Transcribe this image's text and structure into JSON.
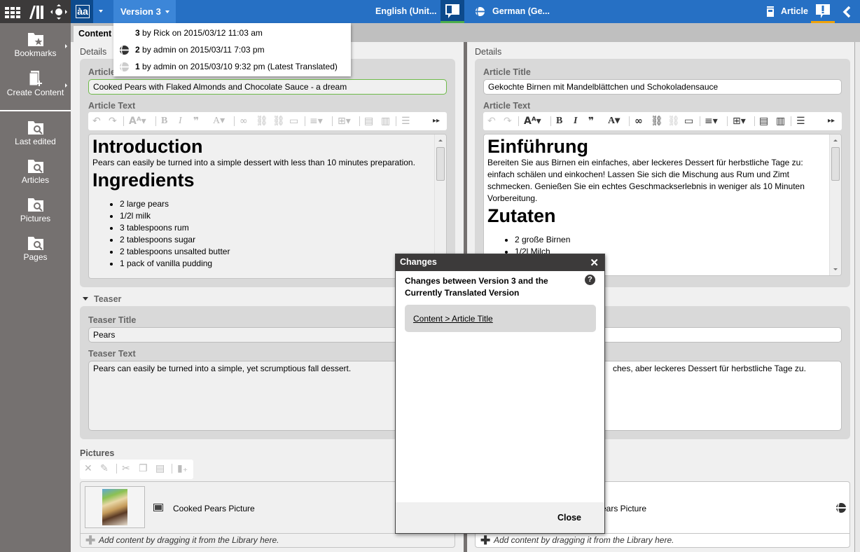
{
  "app_bar": {
    "icons": [
      "apps-grid-icon",
      "library-icon",
      "navigation-icon"
    ]
  },
  "sidebar": {
    "items": [
      {
        "label": "Bookmarks",
        "icon": "bookmark-folder-icon",
        "has_submenu": true
      },
      {
        "label": "Create Content",
        "icon": "create-content-icon",
        "has_submenu": true
      },
      {
        "label": "Last edited",
        "icon": "folder-search-icon"
      },
      {
        "label": "Articles",
        "icon": "folder-search-icon"
      },
      {
        "label": "Pictures",
        "icon": "folder-search-icon"
      },
      {
        "label": "Pages",
        "icon": "folder-search-icon"
      }
    ]
  },
  "topbar": {
    "language_icon_text": "àa",
    "version_label": "Version 3",
    "source_language": "English (Unit...",
    "target_language": "German (Ge...",
    "doc_type": "Article",
    "accent_compare": "#4cae4c",
    "accent_alert": "#f0a30a",
    "bar_color": "#2670c4"
  },
  "version_menu": {
    "items": [
      {
        "num": "3",
        "text": " by Rick on 2015/03/12 11:03 am",
        "icon": "none"
      },
      {
        "num": "2",
        "text": " by admin on 2015/03/11 7:03 pm",
        "icon": "globe-dark-icon"
      },
      {
        "num": "1",
        "text": " by admin on 2015/03/10 9:32 pm (Latest Translated)",
        "icon": "globe-light-icon"
      }
    ]
  },
  "tabs": {
    "content": "Content"
  },
  "left": {
    "details_label": "Details",
    "article_title_label": "Article Title",
    "article_title_value": "Cooked Pears with Flaked Almonds and Chocolate Sauce  - a dream",
    "article_text_label": "Article Text",
    "article_text": {
      "h1": "Introduction",
      "p": "Pears can easily be turned into a simple dessert with less than 10 minutes preparation.",
      "h2": "Ingredients",
      "list": [
        "2 large pears",
        "1/2l milk",
        "3 tablespoons rum",
        "2 tablespoons sugar",
        "2 tablespoons unsalted butter",
        "1 pack of vanilla pudding"
      ]
    },
    "teaser_label": "Teaser",
    "teaser_title_label": "Teaser Title",
    "teaser_title_value": "Pears",
    "teaser_text_label": "Teaser Text",
    "teaser_text_value": "Pears can easily be turned into a simple, yet scrumptious fall dessert.",
    "pictures_label": "Pictures",
    "picture_name": "Cooked Pears Picture",
    "add_content_hint": "Add content by dragging it from the Library here."
  },
  "right": {
    "details_label": "Details",
    "article_title_label": "Article Title",
    "article_title_value": "Gekochte Birnen mit Mandelblättchen und Schokoladensauce",
    "article_text_label": "Article Text",
    "article_text": {
      "h1": "Einführung",
      "p": "Bereiten Sie aus Birnen ein einfaches, aber leckeres Dessert für herbstliche Tage zu: einfach schälen und einkochen! Lassen Sie sich die Mischung aus Rum und Zimt schmecken. Genießen Sie ein echtes Geschmackserlebnis in weniger als 10 Minuten Vorbereitung.",
      "h2": "Zutaten",
      "list": [
        "2 große Birnen",
        "1/2l Milch"
      ]
    },
    "teaser_text_value": "ches, aber leckeres Dessert für herbstliche Tage zu.",
    "picture_name": "ears Picture",
    "add_content_hint": "Add content by dragging it from the Library here."
  },
  "dialog": {
    "title": "Changes",
    "heading": "Changes between Version 3 and the Currently Translated Version",
    "change_link": "Content > Article Title",
    "close_label": "Close",
    "help_glyph": "?",
    "close_glyph": "✕"
  }
}
